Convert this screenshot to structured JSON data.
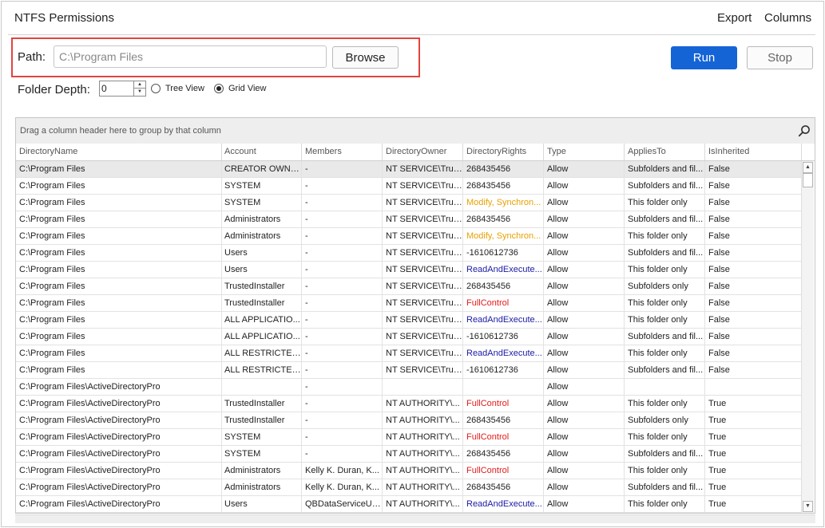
{
  "window": {
    "title": "NTFS Permissions"
  },
  "menu": {
    "export_label": "Export",
    "columns_label": "Columns"
  },
  "path": {
    "label": "Path:",
    "value": "C:\\Program Files",
    "browse_label": "Browse"
  },
  "actions": {
    "run_label": "Run",
    "stop_label": "Stop",
    "run_color": "#1464d6"
  },
  "options": {
    "folder_depth_label": "Folder Depth:",
    "folder_depth_value": "0",
    "tree_view_label": "Tree View",
    "grid_view_label": "Grid View",
    "selected_view": "Grid View"
  },
  "grid": {
    "group_panel_text": "Drag a column header here to group by that column",
    "columns": [
      "DirectoryName",
      "Account",
      "Members",
      "DirectoryOwner",
      "DirectoryRights",
      "Type",
      "AppliesTo",
      "IsInherited"
    ],
    "rights_colors": {
      "orange": "#e8a000",
      "blue": "#1a1aa6",
      "red": "#e21b1b"
    },
    "rows": [
      {
        "dir": "C:\\Program Files",
        "account": "CREATOR OWNER",
        "members": "-",
        "owner": "NT SERVICE\\Trus...",
        "rights": "268435456",
        "rights_color": "",
        "type": "Allow",
        "applies": "Subfolders and fil...",
        "inherited": "False",
        "selected": true
      },
      {
        "dir": "C:\\Program Files",
        "account": "SYSTEM",
        "members": "-",
        "owner": "NT SERVICE\\Trus...",
        "rights": "268435456",
        "rights_color": "",
        "type": "Allow",
        "applies": "Subfolders and fil...",
        "inherited": "False"
      },
      {
        "dir": "C:\\Program Files",
        "account": "SYSTEM",
        "members": "-",
        "owner": "NT SERVICE\\Trus...",
        "rights": "Modify, Synchron...",
        "rights_color": "orange",
        "type": "Allow",
        "applies": "This folder only",
        "inherited": "False"
      },
      {
        "dir": "C:\\Program Files",
        "account": "Administrators",
        "members": "-",
        "owner": "NT SERVICE\\Trus...",
        "rights": "268435456",
        "rights_color": "",
        "type": "Allow",
        "applies": "Subfolders and fil...",
        "inherited": "False"
      },
      {
        "dir": "C:\\Program Files",
        "account": "Administrators",
        "members": "-",
        "owner": "NT SERVICE\\Trus...",
        "rights": "Modify, Synchron...",
        "rights_color": "orange",
        "type": "Allow",
        "applies": "This folder only",
        "inherited": "False"
      },
      {
        "dir": "C:\\Program Files",
        "account": "Users",
        "members": "-",
        "owner": "NT SERVICE\\Trus...",
        "rights": "-1610612736",
        "rights_color": "",
        "type": "Allow",
        "applies": "Subfolders and fil...",
        "inherited": "False"
      },
      {
        "dir": "C:\\Program Files",
        "account": "Users",
        "members": "-",
        "owner": "NT SERVICE\\Trus...",
        "rights": "ReadAndExecute...",
        "rights_color": "blue",
        "type": "Allow",
        "applies": "This folder only",
        "inherited": "False"
      },
      {
        "dir": "C:\\Program Files",
        "account": "TrustedInstaller",
        "members": "-",
        "owner": "NT SERVICE\\Trus...",
        "rights": "268435456",
        "rights_color": "",
        "type": "Allow",
        "applies": "Subfolders only",
        "inherited": "False"
      },
      {
        "dir": "C:\\Program Files",
        "account": "TrustedInstaller",
        "members": "-",
        "owner": "NT SERVICE\\Trus...",
        "rights": "FullControl",
        "rights_color": "red",
        "type": "Allow",
        "applies": "This folder only",
        "inherited": "False"
      },
      {
        "dir": "C:\\Program Files",
        "account": "ALL APPLICATIO...",
        "members": "-",
        "owner": "NT SERVICE\\Trus...",
        "rights": "ReadAndExecute...",
        "rights_color": "blue",
        "type": "Allow",
        "applies": "This folder only",
        "inherited": "False"
      },
      {
        "dir": "C:\\Program Files",
        "account": "ALL APPLICATIO...",
        "members": "-",
        "owner": "NT SERVICE\\Trus...",
        "rights": "-1610612736",
        "rights_color": "",
        "type": "Allow",
        "applies": "Subfolders and fil...",
        "inherited": "False"
      },
      {
        "dir": "C:\\Program Files",
        "account": "ALL RESTRICTED...",
        "members": "-",
        "owner": "NT SERVICE\\Trus...",
        "rights": "ReadAndExecute...",
        "rights_color": "blue",
        "type": "Allow",
        "applies": "This folder only",
        "inherited": "False"
      },
      {
        "dir": "C:\\Program Files",
        "account": "ALL RESTRICTED...",
        "members": "-",
        "owner": "NT SERVICE\\Trus...",
        "rights": "-1610612736",
        "rights_color": "",
        "type": "Allow",
        "applies": "Subfolders and fil...",
        "inherited": "False"
      },
      {
        "dir": "C:\\Program Files\\ActiveDirectoryPro",
        "account": "",
        "members": "-",
        "owner": "",
        "rights": "",
        "rights_color": "",
        "type": "Allow",
        "applies": "",
        "inherited": ""
      },
      {
        "dir": "C:\\Program Files\\ActiveDirectoryPro",
        "account": "TrustedInstaller",
        "members": "-",
        "owner": "NT AUTHORITY\\...",
        "rights": "FullControl",
        "rights_color": "red",
        "type": "Allow",
        "applies": "This folder only",
        "inherited": "True"
      },
      {
        "dir": "C:\\Program Files\\ActiveDirectoryPro",
        "account": "TrustedInstaller",
        "members": "-",
        "owner": "NT AUTHORITY\\...",
        "rights": "268435456",
        "rights_color": "",
        "type": "Allow",
        "applies": "Subfolders only",
        "inherited": "True"
      },
      {
        "dir": "C:\\Program Files\\ActiveDirectoryPro",
        "account": "SYSTEM",
        "members": "-",
        "owner": "NT AUTHORITY\\...",
        "rights": "FullControl",
        "rights_color": "red",
        "type": "Allow",
        "applies": "This folder only",
        "inherited": "True"
      },
      {
        "dir": "C:\\Program Files\\ActiveDirectoryPro",
        "account": "SYSTEM",
        "members": "-",
        "owner": "NT AUTHORITY\\...",
        "rights": "268435456",
        "rights_color": "",
        "type": "Allow",
        "applies": "Subfolders and fil...",
        "inherited": "True"
      },
      {
        "dir": "C:\\Program Files\\ActiveDirectoryPro",
        "account": "Administrators",
        "members": "Kelly K. Duran, K...",
        "owner": "NT AUTHORITY\\...",
        "rights": "FullControl",
        "rights_color": "red",
        "type": "Allow",
        "applies": "This folder only",
        "inherited": "True"
      },
      {
        "dir": "C:\\Program Files\\ActiveDirectoryPro",
        "account": "Administrators",
        "members": "Kelly K. Duran, K...",
        "owner": "NT AUTHORITY\\...",
        "rights": "268435456",
        "rights_color": "",
        "type": "Allow",
        "applies": "Subfolders and fil...",
        "inherited": "True"
      },
      {
        "dir": "C:\\Program Files\\ActiveDirectoryPro",
        "account": "Users",
        "members": "QBDataServiceUs...",
        "owner": "NT AUTHORITY\\...",
        "rights": "ReadAndExecute...",
        "rights_color": "blue",
        "type": "Allow",
        "applies": "This folder only",
        "inherited": "True"
      }
    ]
  }
}
